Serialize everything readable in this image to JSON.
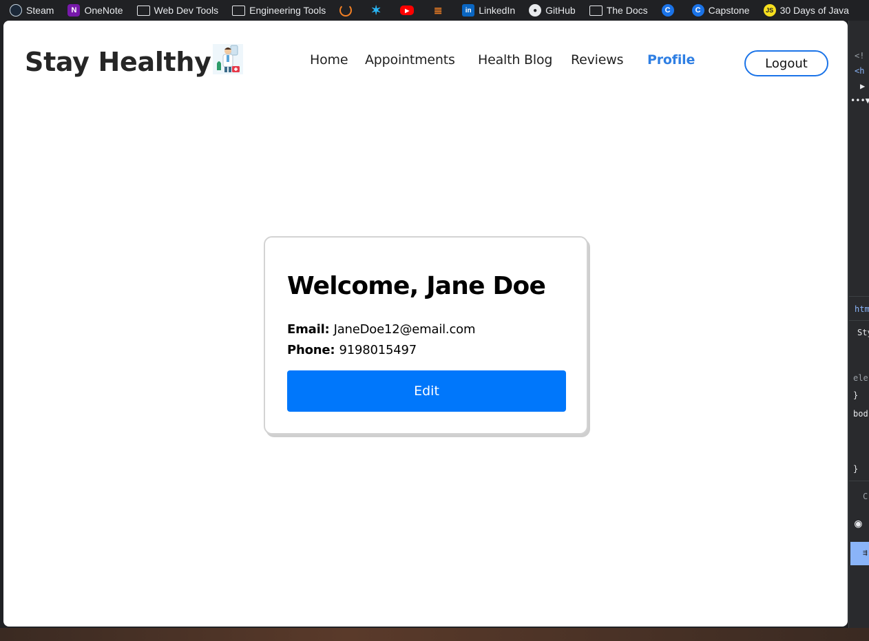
{
  "bookmarks": [
    {
      "label": "Steam",
      "icon": "steam-icon",
      "glyph": ""
    },
    {
      "label": "OneNote",
      "icon": "onenote-icon",
      "glyph": "N"
    },
    {
      "label": "Web Dev Tools",
      "icon": "folder-icon",
      "glyph": ""
    },
    {
      "label": "Engineering Tools",
      "icon": "folder-icon",
      "glyph": ""
    },
    {
      "label": "",
      "icon": "orange-ring-icon",
      "glyph": ""
    },
    {
      "label": "",
      "icon": "star-icon",
      "glyph": "✶"
    },
    {
      "label": "",
      "icon": "youtube-icon",
      "glyph": "▶"
    },
    {
      "label": "",
      "icon": "stackoverflow-icon",
      "glyph": "≣"
    },
    {
      "label": "LinkedIn",
      "icon": "linkedin-icon",
      "glyph": "in"
    },
    {
      "label": "GitHub",
      "icon": "github-icon",
      "glyph": "●"
    },
    {
      "label": "The Docs",
      "icon": "folder-icon",
      "glyph": ""
    },
    {
      "label": "",
      "icon": "c-icon",
      "glyph": "C"
    },
    {
      "label": "Capstone",
      "icon": "c-icon",
      "glyph": "C"
    },
    {
      "label": "30 Days of Java",
      "icon": "js-icon",
      "glyph": "JS"
    }
  ],
  "header": {
    "brand": "Stay Healthy",
    "logo_icon": "doctor-icon",
    "nav": {
      "home": "Home",
      "appointments": "Appointments",
      "health_blog": "Health Blog",
      "reviews": "Reviews",
      "profile": "Profile"
    },
    "logout_label": "Logout"
  },
  "profile_card": {
    "title": "Welcome, Jane Doe",
    "email_label": "Email:",
    "email_value": "JaneDoe12@email.com",
    "phone_label": "Phone:",
    "phone_value": "9198015497",
    "edit_label": "Edit"
  },
  "devtools": {
    "lines": [
      "<!",
      "<h",
      "▶",
      "•••▼",
      "htm",
      "Sty",
      "ele",
      "}",
      "bod",
      "}",
      "C",
      "◉",
      "⇶"
    ]
  },
  "colors": {
    "accent": "#0077fb",
    "nav_active": "#2f7fe3",
    "logout_border": "#1a73e8"
  }
}
